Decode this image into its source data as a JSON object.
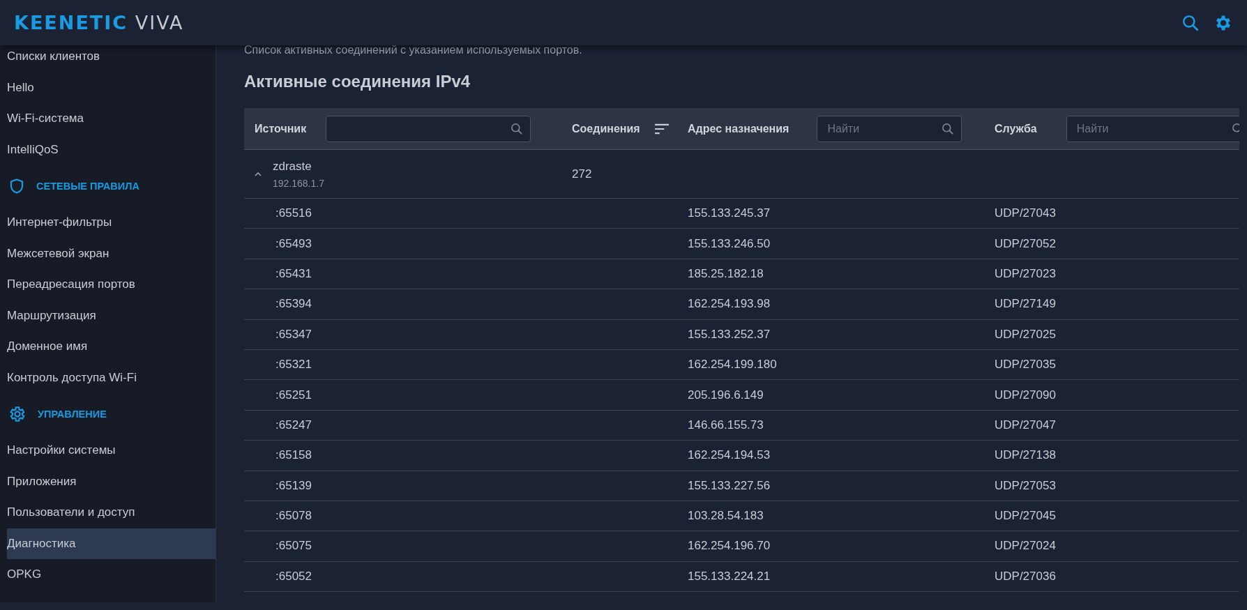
{
  "header": {
    "logo": "KEENETIC",
    "model": "VIVA"
  },
  "sidebar": {
    "items": [
      {
        "kind": "item",
        "label": "Списки клиентов",
        "selected": false
      },
      {
        "kind": "item",
        "label": "Hello",
        "selected": false
      },
      {
        "kind": "item",
        "label": "Wi-Fi-система",
        "selected": false
      },
      {
        "kind": "item",
        "label": "IntelliQoS",
        "selected": false
      },
      {
        "kind": "section",
        "label": "СЕТЕВЫЕ ПРАВИЛА"
      },
      {
        "kind": "item",
        "label": "Интернет-фильтры",
        "selected": false
      },
      {
        "kind": "item",
        "label": "Межсетевой экран",
        "selected": false
      },
      {
        "kind": "item",
        "label": "Переадресация портов",
        "selected": false
      },
      {
        "kind": "item",
        "label": "Маршрутизация",
        "selected": false
      },
      {
        "kind": "item",
        "label": "Доменное имя",
        "selected": false
      },
      {
        "kind": "item",
        "label": "Контроль доступа Wi-Fi",
        "selected": false
      },
      {
        "kind": "section",
        "label": "УПРАВЛЕНИЕ"
      },
      {
        "kind": "item",
        "label": "Настройки системы",
        "selected": false
      },
      {
        "kind": "item",
        "label": "Приложения",
        "selected": false
      },
      {
        "kind": "item",
        "label": "Пользователи и доступ",
        "selected": false
      },
      {
        "kind": "item",
        "label": "Диагностика",
        "selected": true
      },
      {
        "kind": "item",
        "label": "OPKG",
        "selected": false
      }
    ]
  },
  "content": {
    "description": "Список активных соединений с указанием используемых портов.",
    "title": "Активные соединения IPv4",
    "table": {
      "columns": [
        {
          "label": "Источник",
          "kind": "search"
        },
        {
          "label": "Соединения",
          "kind": "sort"
        },
        {
          "label": "Адрес назначения",
          "kind": "search",
          "placeholder": "Найти"
        },
        {
          "label": "Служба",
          "kind": "search",
          "placeholder": "Найти"
        }
      ],
      "group": {
        "name": "zdraste",
        "ip": "192.168.1.7",
        "count": "272",
        "expanded": true
      },
      "rows": [
        {
          "source": ":65516",
          "destination": "155.133.245.37",
          "service": "UDP/27043"
        },
        {
          "source": ":65493",
          "destination": "155.133.246.50",
          "service": "UDP/27052"
        },
        {
          "source": ":65431",
          "destination": "185.25.182.18",
          "service": "UDP/27023"
        },
        {
          "source": ":65394",
          "destination": "162.254.193.98",
          "service": "UDP/27149"
        },
        {
          "source": ":65347",
          "destination": "155.133.252.37",
          "service": "UDP/27025"
        },
        {
          "source": ":65321",
          "destination": "162.254.199.180",
          "service": "UDP/27035"
        },
        {
          "source": ":65251",
          "destination": "205.196.6.149",
          "service": "UDP/27090"
        },
        {
          "source": ":65247",
          "destination": "146.66.155.73",
          "service": "UDP/27047"
        },
        {
          "source": ":65158",
          "destination": "162.254.194.53",
          "service": "UDP/27138"
        },
        {
          "source": ":65139",
          "destination": "155.133.227.56",
          "service": "UDP/27053"
        },
        {
          "source": ":65078",
          "destination": "103.28.54.183",
          "service": "UDP/27045"
        },
        {
          "source": ":65075",
          "destination": "162.254.196.70",
          "service": "UDP/27024"
        },
        {
          "source": ":65052",
          "destination": "155.133.224.21",
          "service": "UDP/27036"
        }
      ]
    }
  }
}
